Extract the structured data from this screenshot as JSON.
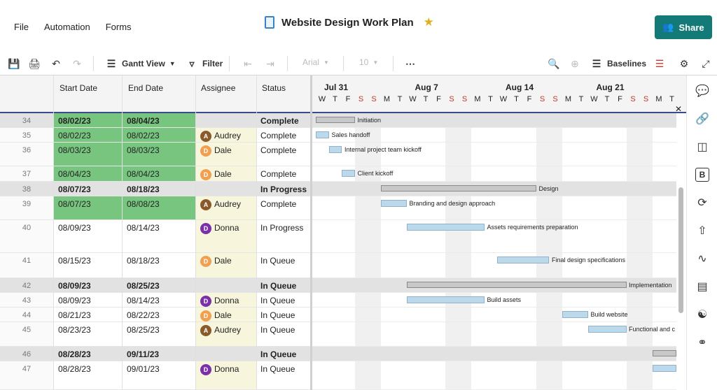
{
  "menu": [
    "File",
    "Automation",
    "Forms"
  ],
  "title": "Website Design Work Plan",
  "share_label": "Share",
  "toolbar": {
    "view_label": "Gantt View",
    "filter_label": "Filter",
    "font_label": "Arial",
    "size_label": "10",
    "baselines_label": "Baselines"
  },
  "grid_headers": [
    "Start Date",
    "End Date",
    "Assignee",
    "Status"
  ],
  "rows": [
    {
      "num": "34",
      "start": "08/02/23",
      "end": "08/04/23",
      "assignee": "",
      "status": "Complete",
      "type": "summary-green"
    },
    {
      "num": "35",
      "start": "08/02/23",
      "end": "08/02/23",
      "assignee": "Audrey",
      "status": "Complete",
      "type": "green"
    },
    {
      "num": "36",
      "start": "08/03/23",
      "end": "08/03/23",
      "assignee": "Dale",
      "status": "Complete",
      "type": "green"
    },
    {
      "num": "37",
      "start": "08/04/23",
      "end": "08/04/23",
      "assignee": "Dale",
      "status": "Complete",
      "type": "green"
    },
    {
      "num": "38",
      "start": "08/07/23",
      "end": "08/18/23",
      "assignee": "",
      "status": "In Progress",
      "type": "summary"
    },
    {
      "num": "39",
      "start": "08/07/23",
      "end": "08/08/23",
      "assignee": "Audrey",
      "status": "Complete",
      "type": "green"
    },
    {
      "num": "40",
      "start": "08/09/23",
      "end": "08/14/23",
      "assignee": "Donna",
      "status": "In Progress",
      "type": "normal"
    },
    {
      "num": "41",
      "start": "08/15/23",
      "end": "08/18/23",
      "assignee": "Dale",
      "status": "In Queue",
      "type": "normal"
    },
    {
      "num": "42",
      "start": "08/09/23",
      "end": "08/25/23",
      "assignee": "",
      "status": "In Queue",
      "type": "summary"
    },
    {
      "num": "43",
      "start": "08/09/23",
      "end": "08/14/23",
      "assignee": "Donna",
      "status": "In Queue",
      "type": "normal"
    },
    {
      "num": "44",
      "start": "08/21/23",
      "end": "08/22/23",
      "assignee": "Dale",
      "status": "In Queue",
      "type": "normal"
    },
    {
      "num": "45",
      "start": "08/23/23",
      "end": "08/25/23",
      "assignee": "Audrey",
      "status": "In Queue",
      "type": "normal"
    },
    {
      "num": "46",
      "start": "08/28/23",
      "end": "09/11/23",
      "assignee": "",
      "status": "In Queue",
      "type": "summary"
    },
    {
      "num": "47",
      "start": "08/28/23",
      "end": "09/01/23",
      "assignee": "Donna",
      "status": "In Queue",
      "type": "normal"
    }
  ],
  "avatars": {
    "Audrey": {
      "initial": "A",
      "color": "#8a5a2b"
    },
    "Dale": {
      "initial": "D",
      "color": "#f0a050"
    },
    "Donna": {
      "initial": "D",
      "color": "#7b2fa8"
    }
  },
  "gantt": {
    "weeks": [
      "Jul 31",
      "Aug 7",
      "Aug 14",
      "Aug 21"
    ],
    "days": [
      "W",
      "T",
      "F",
      "S",
      "S",
      "M",
      "T",
      "W",
      "T",
      "F",
      "S",
      "S",
      "M",
      "T",
      "W",
      "T",
      "F",
      "S",
      "S",
      "M",
      "T",
      "W",
      "T",
      "F",
      "S",
      "S",
      "M",
      "T"
    ],
    "task_labels": [
      "Initiation",
      "Sales handoff",
      "Internal project team kickoff",
      "Client kickoff",
      "Design",
      "Branding and design approach",
      "Assets requirements preparation",
      "Final design specifications",
      "Implementation",
      "Build assets",
      "Build website",
      "Functional and c",
      "",
      ""
    ]
  },
  "colors": {
    "accent": "#137a78",
    "complete_green": "#78c57f",
    "assignee_bg": "#f7f6dd",
    "bar": "#bcd9ec"
  },
  "rail_icons": [
    "comment-icon",
    "link-icon",
    "layers-icon",
    "bold-b-icon",
    "sync-icon",
    "upload-icon",
    "activity-icon",
    "summary-icon",
    "people-icon",
    "connector-icon"
  ]
}
